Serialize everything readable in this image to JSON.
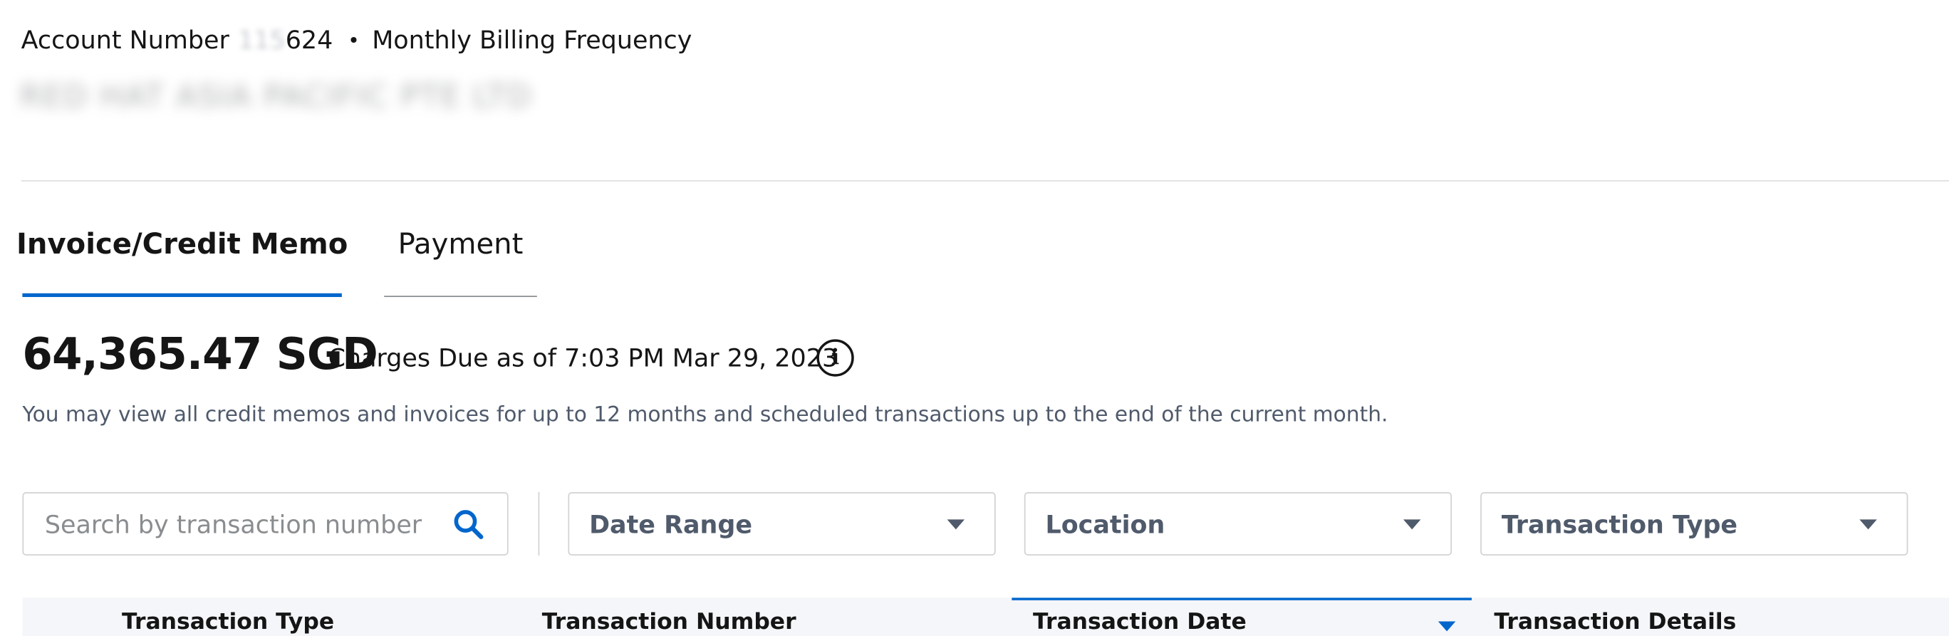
{
  "account": {
    "label": "Account Number",
    "number_masked": "115",
    "number_visible": "624",
    "separator": "•",
    "billing_frequency": "Monthly Billing Frequency",
    "name": "RED HAT ASIA PACIFIC PTE LTD"
  },
  "tabs": [
    {
      "label": "Invoice/Credit Memo",
      "active": true
    },
    {
      "label": "Payment",
      "active": false
    }
  ],
  "charges": {
    "amount": "64,365.47 SGD",
    "due_text": "Charges Due as of 7:03 PM Mar 29, 2023",
    "info_glyph": "i",
    "note": "You may view all credit memos and invoices for up to 12 months and scheduled transactions up to the end of the current month."
  },
  "filters": {
    "search_placeholder": "Search by transaction number",
    "search_value": "",
    "date_range": "Date Range",
    "location": "Location",
    "transaction_type": "Transaction Type"
  },
  "table": {
    "columns": [
      {
        "label": "Transaction Type"
      },
      {
        "label": "Transaction Number"
      },
      {
        "label": "Transaction Date",
        "sorted": "descending"
      },
      {
        "label": "Transaction Details"
      }
    ]
  },
  "colors": {
    "accent": "#0066cc",
    "muted_text": "#4f5a6b",
    "header_bg": "#f4f6f9"
  },
  "icons": [
    "search-icon",
    "info-icon",
    "chevron-down-icon",
    "sort-desc-icon"
  ]
}
